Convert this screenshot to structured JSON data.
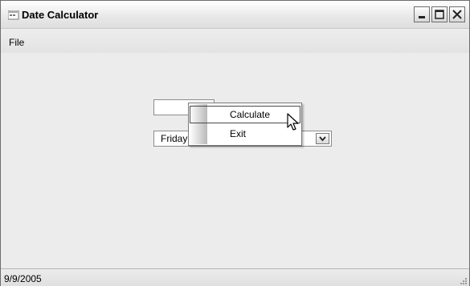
{
  "window": {
    "title": "Date Calculator"
  },
  "menu": {
    "file_label": "File"
  },
  "form": {
    "text_input_value": "",
    "day_combo_value": "Friday"
  },
  "context_menu": {
    "items": [
      {
        "label": "Calculate"
      },
      {
        "label": "Exit"
      }
    ]
  },
  "status": {
    "text": "9/9/2005"
  }
}
